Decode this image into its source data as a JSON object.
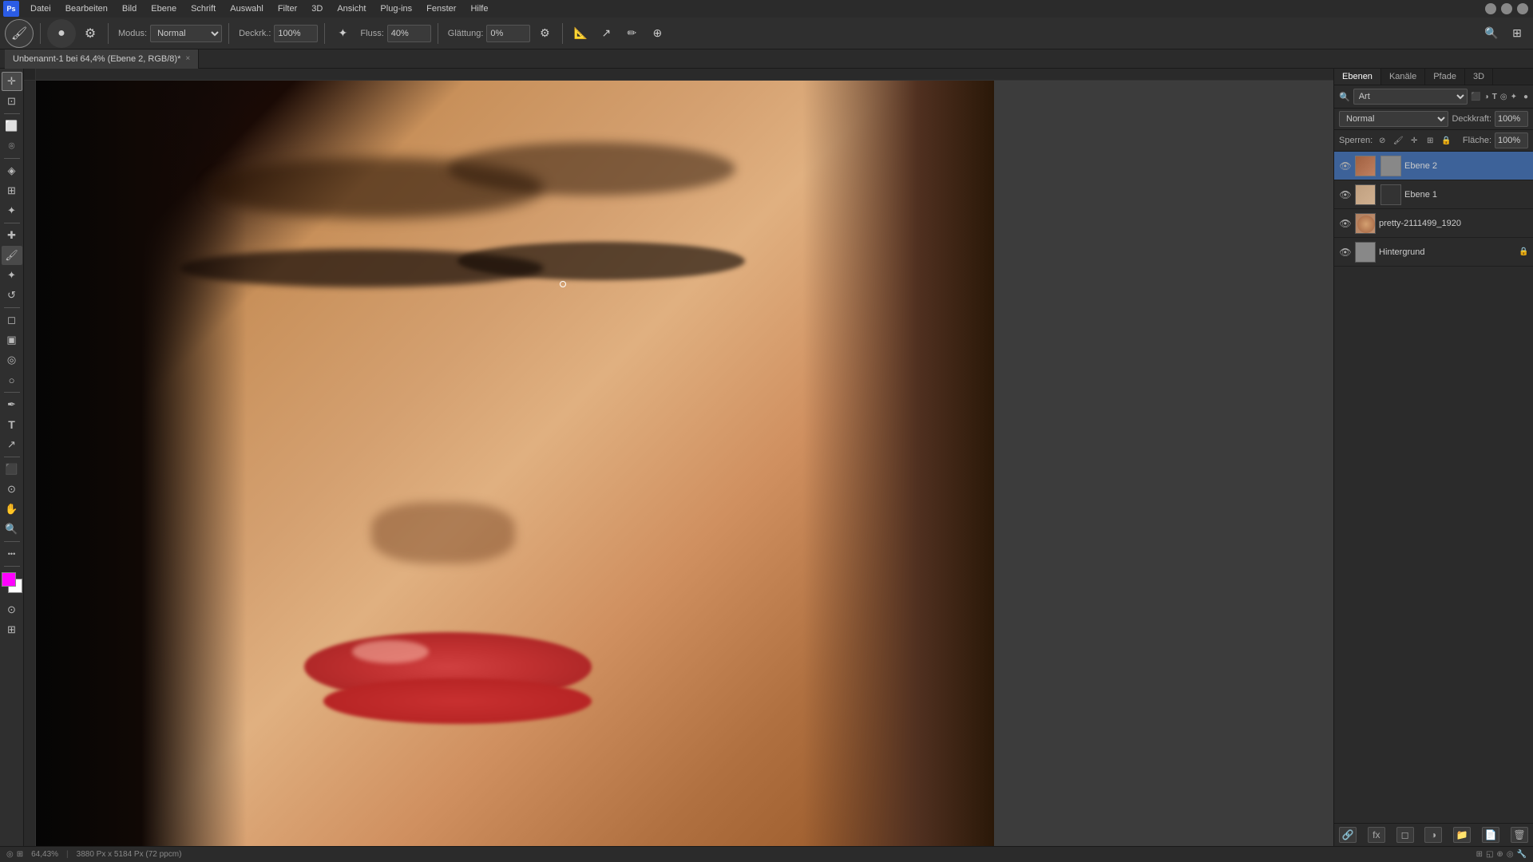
{
  "app": {
    "title": "Adobe Photoshop",
    "menu": [
      "Datei",
      "Bearbeiten",
      "Bild",
      "Ebene",
      "Schrift",
      "Auswahl",
      "Filter",
      "3D",
      "Ansicht",
      "Plug-ins",
      "Fenster",
      "Hilfe"
    ]
  },
  "toolbar": {
    "mode_label": "Modus:",
    "mode_value": "Normal",
    "density_label": "Deckrk.:",
    "density_value": "100%",
    "flow_label": "Fluss:",
    "flow_value": "40%",
    "smoothing_label": "Glättung:",
    "smoothing_value": "0%"
  },
  "tab": {
    "title": "Unbenannt-1 bei 64,4% (Ebene 2, RGB/8)*",
    "close": "×"
  },
  "layers_panel": {
    "tabs": [
      "Ebenen",
      "Kanäle",
      "Pfade",
      "3D"
    ],
    "search_placeholder": "Art",
    "blend_mode": "Normal",
    "opacity_label": "Deckkraft:",
    "opacity_value": "100%",
    "fill_label": "Fläche:",
    "fill_value": "100%",
    "layers": [
      {
        "name": "Ebene 2",
        "visible": true,
        "thumb_color": "#a06040",
        "mask_color": "#888888",
        "locked": false,
        "active": true
      },
      {
        "name": "Ebene 1",
        "visible": true,
        "thumb_color": "#c0a080",
        "mask_color": "#444444",
        "locked": false,
        "active": false
      },
      {
        "name": "pretty-2111499_1920",
        "visible": true,
        "thumb_color": "#b08060",
        "mask_color": null,
        "locked": false,
        "active": false
      },
      {
        "name": "Hintergrund",
        "visible": true,
        "thumb_color": "#808080",
        "mask_color": null,
        "locked": true,
        "active": false
      }
    ]
  },
  "statusbar": {
    "zoom": "64,43%",
    "info": "3880 Px x 5184 Px (72 ppcm)"
  },
  "colors": {
    "foreground": "#ff00ff",
    "background": "#ffffff"
  }
}
